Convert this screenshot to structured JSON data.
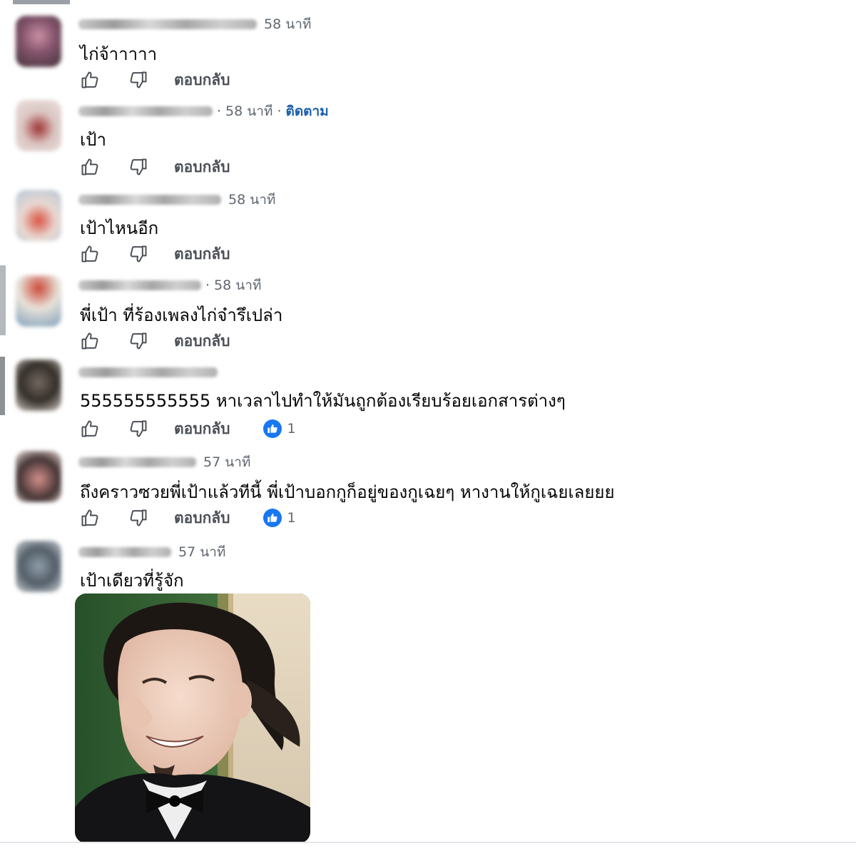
{
  "comments": [
    {
      "time": "58 นาที",
      "text": "ไก่จ้าาาาา",
      "reply_label": "ตอบกลับ",
      "avatar_colors": [
        "#7b4a63",
        "#c98aa0",
        "#3d2b33"
      ]
    },
    {
      "time": "58 นาที",
      "follow_label": "ติดตาม",
      "text": "เป้า",
      "reply_label": "ตอบกลับ",
      "avatar_colors": [
        "#d9c3bf",
        "#9a2a2a",
        "#e9dfdc"
      ]
    },
    {
      "time": "58 นาที",
      "text": "เป้าไหนอีก",
      "reply_label": "ตอบกลับ",
      "avatar_colors": [
        "#b3c5d6",
        "#d94b3a",
        "#e8d6cf"
      ]
    },
    {
      "time": "58 นาที",
      "text": "พี่เป้า ที่ร้องเพลงไก่จ๋ารึเปล่า",
      "reply_label": "ตอบกลับ",
      "avatar_colors": [
        "#c9402f",
        "#e8e2d8",
        "#7a9bb8"
      ]
    },
    {
      "time": "",
      "text": "555555555555 หาเวลาไปทำให้มันถูกต้องเรียบร้อยเอกสารต่างๆ",
      "reply_label": "ตอบกลับ",
      "reaction_count": "1",
      "avatar_colors": [
        "#2a241f",
        "#6b6158",
        "#cfc7be"
      ]
    },
    {
      "time": "57 นาที",
      "text": "ถึงคราวซวยพี่เป้าแล้วทีนี้ พี่เป้าบอกกูก็อยู่ของกูเฉยๆ หางานให้กูเฉยเลยยย",
      "reply_label": "ตอบกลับ",
      "reaction_count": "1",
      "avatar_colors": [
        "#3b2a2a",
        "#d28a86",
        "#f0e3e0"
      ]
    },
    {
      "time": "57 นาที",
      "text": "เป้าเดียวที่รู้จัก",
      "reply_label": "ตอบกลับ",
      "avatar_colors": [
        "#4a5560",
        "#8a9aa6",
        "#c7ced3"
      ]
    }
  ],
  "colors": {
    "link": "#1b5fa8",
    "reaction": "#1877f2",
    "meta": "#606770"
  }
}
